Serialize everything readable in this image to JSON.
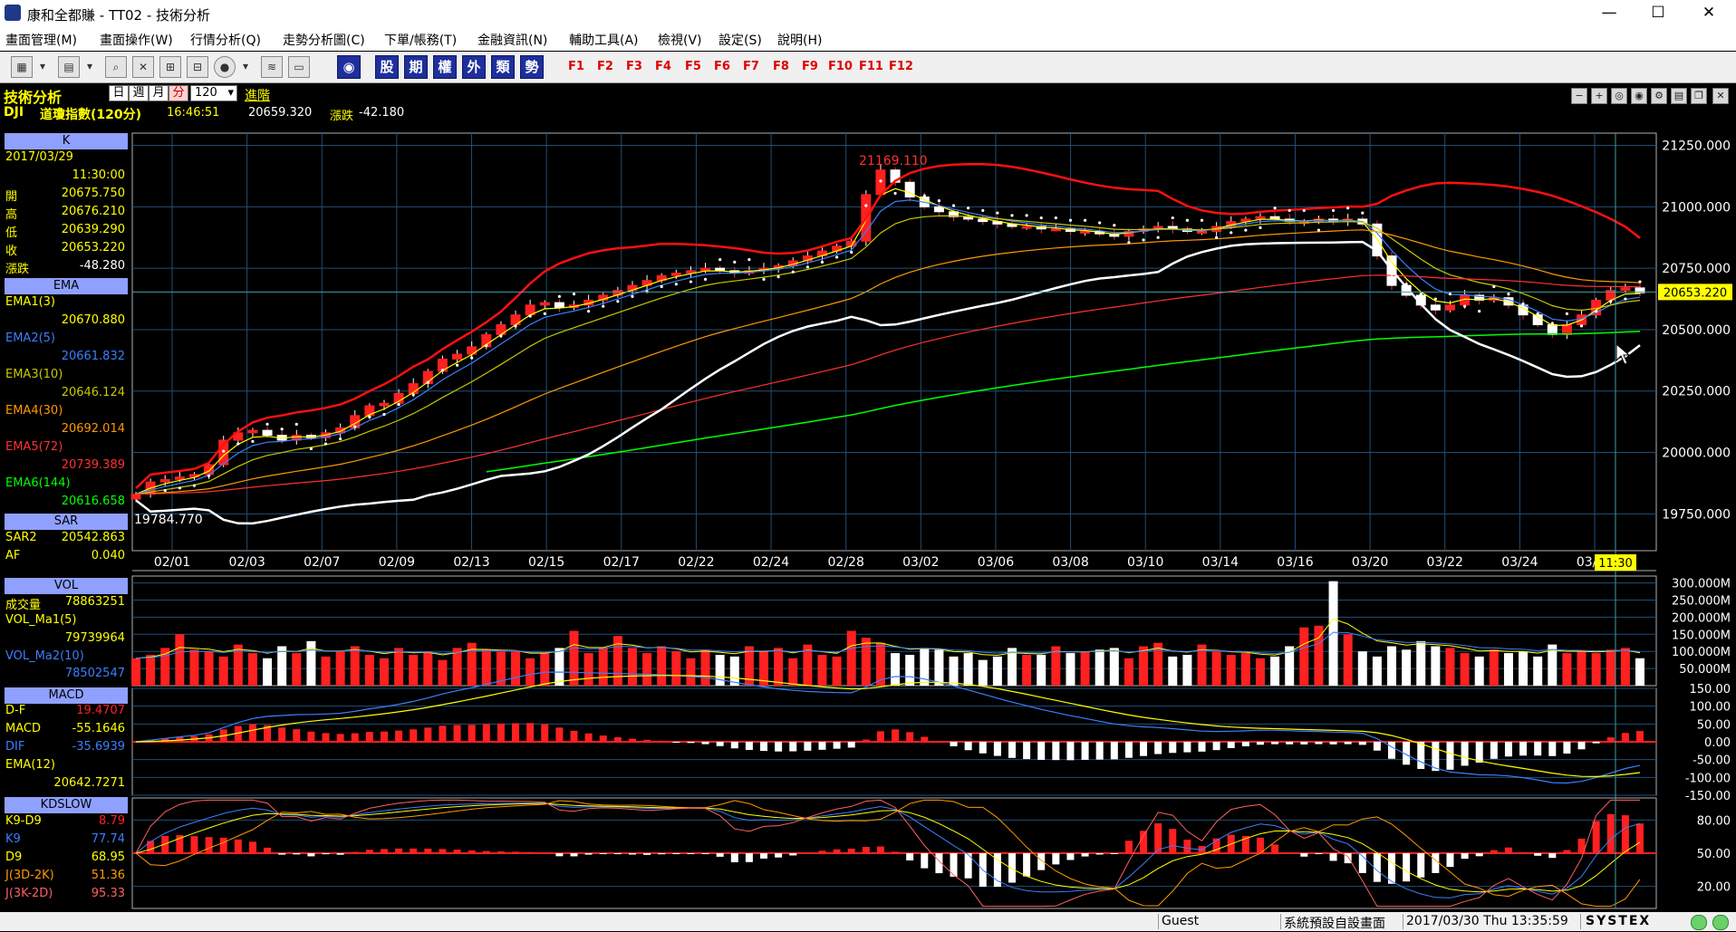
{
  "window": {
    "title": "康和全都賺 - TT02 - 技術分析",
    "min_label": "—",
    "max_label": "☐",
    "close_label": "✕"
  },
  "menu": [
    "畫面管理(M)",
    "畫面操作(W)",
    "行情分析(Q)",
    "走勢分析圖(C)",
    "下單/帳務(T)",
    "金融資訊(N)",
    "輔助工具(A)",
    "檢視(V)",
    "設定(S)",
    "說明(H)"
  ],
  "toolbar": {
    "quick_buttons": [
      "股",
      "期",
      "權",
      "外",
      "類",
      "勢"
    ],
    "function_keys": [
      "F1",
      "F2",
      "F3",
      "F4",
      "F5",
      "F6",
      "F7",
      "F8",
      "F9",
      "F10",
      "F11",
      "F12"
    ]
  },
  "header": {
    "section_title": "技術分析",
    "periods": [
      "日",
      "週",
      "月",
      "分"
    ],
    "active_period": "分",
    "interval": "120",
    "advanced_label": "進階",
    "symbol": "DJI",
    "symbol_name": "道瓊指數(120分)",
    "time": "16:46:51",
    "price": "20659.320",
    "change_label": "漲跌",
    "change": "-42.180"
  },
  "panels": {
    "k": {
      "title": "K",
      "date": "2017/03/29",
      "time": "11:30:00",
      "rows": [
        {
          "label": "開",
          "value": "20675.750"
        },
        {
          "label": "高",
          "value": "20676.210"
        },
        {
          "label": "低",
          "value": "20639.290"
        },
        {
          "label": "收",
          "value": "20653.220"
        },
        {
          "label": "漲跌",
          "value": "-48.280"
        }
      ]
    },
    "ema": {
      "title": "EMA",
      "rows": [
        {
          "label": "EMA1(3)",
          "value": "20670.880",
          "color": "#ffff00"
        },
        {
          "label": "EMA2(5)",
          "value": "20661.832",
          "color": "#3a7fff"
        },
        {
          "label": "EMA3(10)",
          "value": "20646.124",
          "color": "#c8c800"
        },
        {
          "label": "EMA4(30)",
          "value": "20692.014",
          "color": "#ff9900"
        },
        {
          "label": "EMA5(72)",
          "value": "20739.389",
          "color": "#ff3030"
        },
        {
          "label": "EMA6(144)",
          "value": "20616.658",
          "color": "#00ff00"
        }
      ]
    },
    "sar": {
      "title": "SAR",
      "rows": [
        {
          "label": "SAR2",
          "value": "20542.863"
        },
        {
          "label": "AF",
          "value": "0.040"
        }
      ]
    },
    "vol": {
      "title": "VOL",
      "rows": [
        {
          "label": "成交量",
          "value": "78863251",
          "color": "#ffff00"
        },
        {
          "label": "VOL_Ma1(5)",
          "value": "79739964",
          "color": "#ffff00"
        },
        {
          "label": "VOL_Ma2(10)",
          "value": "78502547",
          "color": "#3a7fff"
        }
      ]
    },
    "macd": {
      "title": "MACD",
      "rows": [
        {
          "label": "D-F",
          "value": "19.4707",
          "color": "#ff2020"
        },
        {
          "label": "MACD",
          "value": "-55.1646",
          "color": "#ffff00"
        },
        {
          "label": "DIF",
          "value": "-35.6939",
          "color": "#3a7fff"
        },
        {
          "label": "EMA(12)",
          "value": "20642.7271",
          "color": "#ffff00"
        }
      ]
    },
    "kd": {
      "title": "KDSLOW",
      "rows": [
        {
          "label": "K9-D9",
          "value": "8.79",
          "color": "#ff2020"
        },
        {
          "label": "K9",
          "value": "77.74",
          "color": "#3a7fff"
        },
        {
          "label": "D9",
          "value": "68.95",
          "color": "#ffff00"
        },
        {
          "label": "J(3D-2K)",
          "value": "51.36",
          "color": "#ff9900"
        },
        {
          "label": "J(3K-2D)",
          "value": "95.33",
          "color": "#ff6060"
        }
      ]
    }
  },
  "chart_data": {
    "type": "candlestick",
    "x_ticks": [
      "02/01",
      "02/03",
      "02/07",
      "02/09",
      "02/13",
      "02/15",
      "02/17",
      "02/22",
      "02/24",
      "02/28",
      "03/02",
      "03/06",
      "03/08",
      "03/10",
      "03/14",
      "03/16",
      "03/20",
      "03/22",
      "03/24",
      "03/28"
    ],
    "cursor_time": "11:30",
    "price_axis": {
      "ticks": [
        "21250.000",
        "21000.000",
        "20750.000",
        "20500.000",
        "20250.000",
        "20000.000",
        "19750.000"
      ],
      "range": [
        19600,
        21300
      ]
    },
    "current_price": "20653.220",
    "max_label": "21169.110",
    "min_label": "19784.770",
    "close_series": [
      19830,
      19880,
      19890,
      19900,
      19910,
      19950,
      20050,
      20080,
      20090,
      20070,
      20050,
      20070,
      20060,
      20080,
      20100,
      20150,
      20190,
      20200,
      20240,
      20280,
      20330,
      20380,
      20400,
      20430,
      20480,
      20520,
      20560,
      20600,
      20610,
      20590,
      20600,
      20620,
      20640,
      20660,
      20680,
      20700,
      20720,
      20730,
      20740,
      20750,
      20740,
      20730,
      20740,
      20750,
      20760,
      20780,
      20800,
      20820,
      20840,
      20860,
      21050,
      21150,
      21100,
      21040,
      21000,
      20980,
      20960,
      20950,
      20940,
      20930,
      20920,
      20920,
      20910,
      20910,
      20900,
      20900,
      20890,
      20880,
      20900,
      20910,
      20920,
      20910,
      20900,
      20900,
      20920,
      20940,
      20950,
      20960,
      20950,
      20940,
      20940,
      20950,
      20940,
      20950,
      20930,
      20800,
      20680,
      20640,
      20600,
      20580,
      20600,
      20640,
      20620,
      20630,
      20600,
      20560,
      20520,
      20480,
      20520,
      20560,
      20620,
      20660,
      20670,
      20650
    ],
    "volume_axis": {
      "ticks": [
        "300.000M",
        "250.000M",
        "200.000M",
        "150.000M",
        "100.000M",
        "50.000M"
      ],
      "max": 320
    },
    "volume_m": [
      80,
      90,
      110,
      150,
      105,
      100,
      85,
      120,
      95,
      80,
      115,
      95,
      130,
      85,
      100,
      115,
      90,
      80,
      110,
      90,
      100,
      75,
      110,
      125,
      105,
      100,
      100,
      80,
      95,
      110,
      160,
      95,
      110,
      145,
      110,
      95,
      115,
      100,
      80,
      105,
      90,
      85,
      115,
      100,
      110,
      80,
      120,
      90,
      85,
      160,
      140,
      125,
      95,
      90,
      110,
      105,
      85,
      95,
      75,
      85,
      110,
      90,
      90,
      115,
      95,
      100,
      105,
      110,
      80,
      115,
      125,
      85,
      90,
      120,
      100,
      90,
      95,
      80,
      85,
      115,
      170,
      175,
      305,
      150,
      100,
      85,
      115,
      105,
      130,
      115,
      110,
      95,
      85,
      105,
      95,
      100,
      85,
      120,
      95,
      100,
      95,
      105,
      110,
      80
    ],
    "macd_axis": {
      "ticks": [
        "150.00",
        "100.00",
        "50.00",
        "0.00",
        "-50.00",
        "-100.00",
        "-150.00"
      ],
      "range": [
        -150,
        150
      ]
    },
    "kd_axis": {
      "ticks": [
        "80.00",
        "50.00",
        "20.00"
      ],
      "range": [
        0,
        100
      ]
    }
  },
  "status": {
    "user": "Guest",
    "layout": "系統預設自設畫面",
    "datetime": "2017/03/30 Thu 13:35:59",
    "brand": "SYSTEX"
  }
}
